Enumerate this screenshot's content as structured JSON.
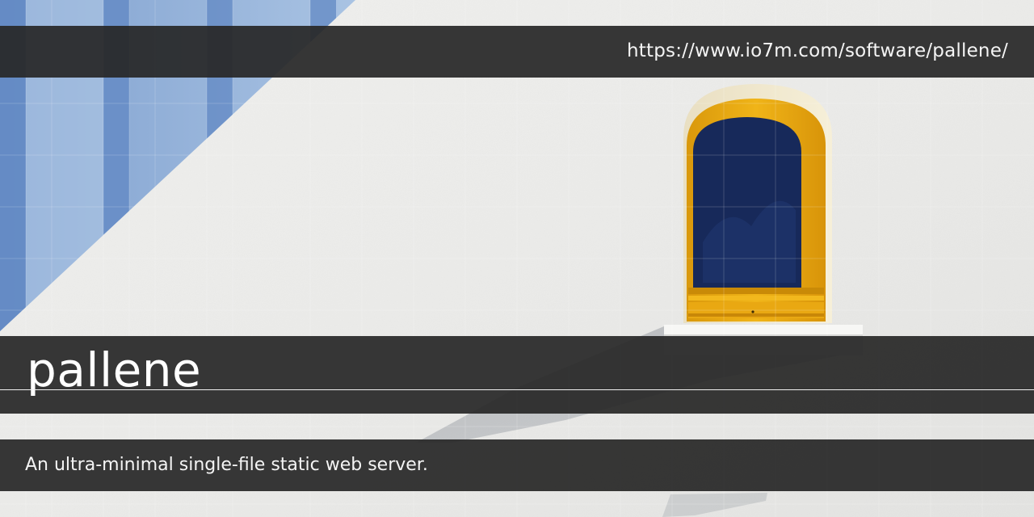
{
  "header": {
    "url": "https://www.io7m.com/software/pallene/"
  },
  "title": "pallene",
  "description": "An ultra-minimal single-file static web server.",
  "colors": {
    "overlay_bar": "#282828",
    "wall": "#ececea",
    "window_frame": "#e5a70e",
    "window_glass": "#17295a",
    "glass_facade": "#8fb0d8",
    "text": "#ffffff"
  },
  "background": {
    "scene": "white stucco wall with arched yellow-framed window and blue glass facade",
    "icons": [
      "window-icon"
    ]
  }
}
